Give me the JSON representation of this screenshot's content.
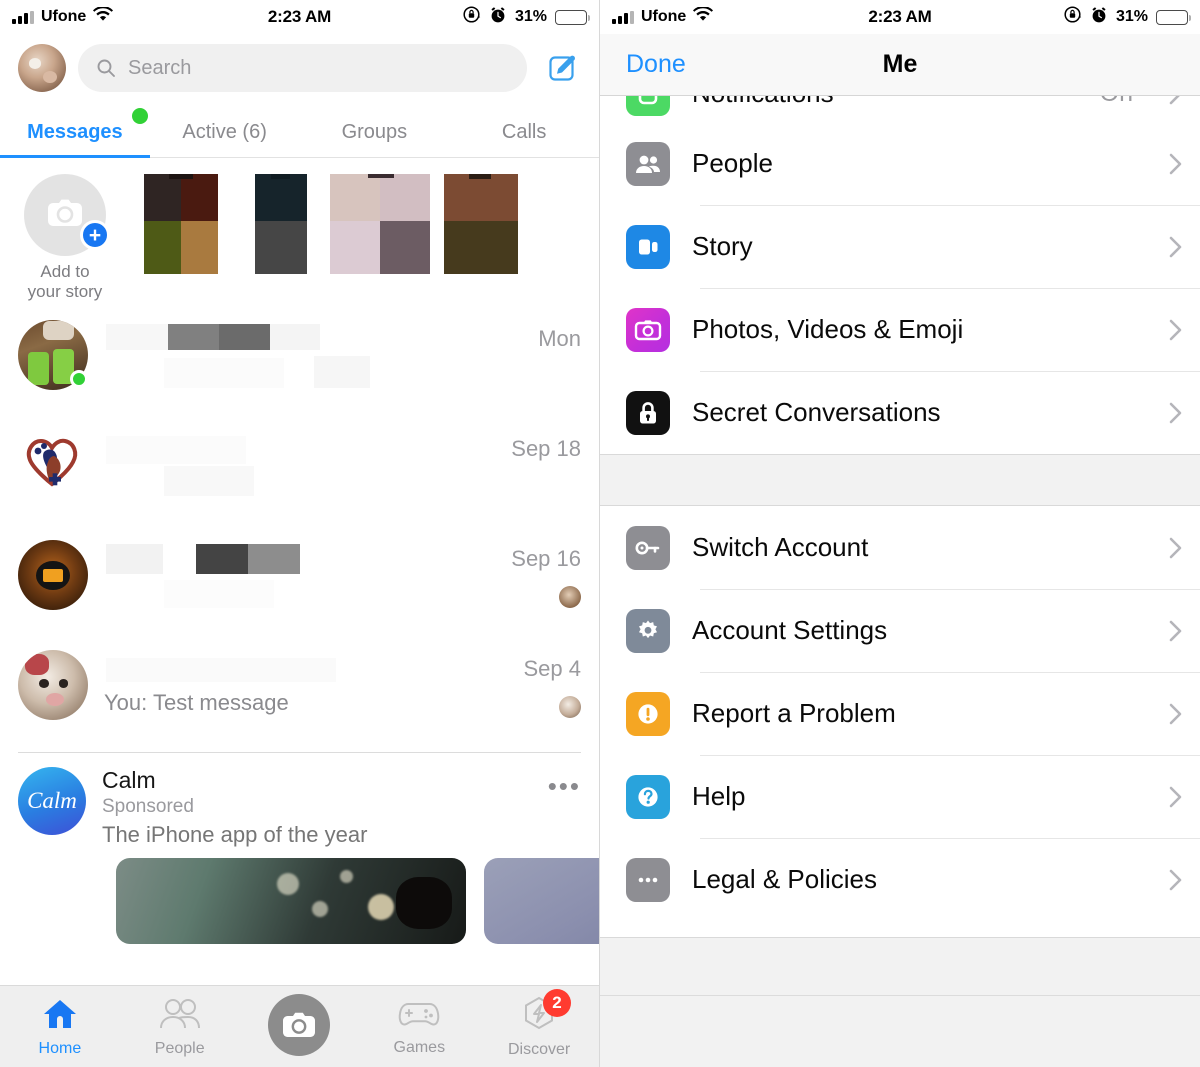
{
  "status_bar": {
    "carrier": "Ufone",
    "time": "2:23 AM",
    "battery_percent": "31%",
    "signal_icon": "cellular-signal-icon",
    "wifi_icon": "wifi-icon",
    "rotation_lock_icon": "rotation-lock-icon",
    "alarm_icon": "alarm-clock-icon",
    "battery_icon": "battery-icon"
  },
  "messenger": {
    "search": {
      "placeholder": "Search"
    },
    "profile_avatar": "user-avatar",
    "compose_icon": "compose-icon",
    "tabs": [
      {
        "label": "Messages",
        "active": true
      },
      {
        "label": "Active (6)",
        "active": false
      },
      {
        "label": "Groups",
        "active": false
      },
      {
        "label": "Calls",
        "active": false
      }
    ],
    "stories": {
      "add_label_line1": "Add to",
      "add_label_line2": "your story",
      "camera_icon": "camera-icon",
      "plus_badge": "+"
    },
    "conversations": [
      {
        "time": "Mon",
        "preview": "",
        "online": true,
        "seen": false
      },
      {
        "time": "Sep 18",
        "preview": "",
        "online": false,
        "seen": false
      },
      {
        "time": "Sep 16",
        "preview": "",
        "online": false,
        "seen": true
      },
      {
        "time": "Sep 4",
        "preview": "You: Test message",
        "online": false,
        "seen": true
      }
    ],
    "sponsored": {
      "logo_text": "Calm",
      "title": "Calm",
      "label": "Sponsored",
      "description": "The iPhone app of the year",
      "more_icon": "more-options-icon"
    },
    "tab_bar": [
      {
        "label": "Home",
        "icon": "home-icon",
        "active": true,
        "badge": ""
      },
      {
        "label": "People",
        "icon": "people-icon",
        "active": false,
        "badge": ""
      },
      {
        "label": "",
        "icon": "camera-icon",
        "active": false,
        "badge": ""
      },
      {
        "label": "Games",
        "icon": "games-controller-icon",
        "active": false,
        "badge": ""
      },
      {
        "label": "Discover",
        "icon": "discover-icon",
        "active": false,
        "badge": "2"
      }
    ]
  },
  "settings_panel": {
    "nav": {
      "done_label": "Done",
      "title": "Me"
    },
    "group1": [
      {
        "label": "Notifications",
        "value": "On",
        "icon": "notifications-icon",
        "icon_color": "#4cd964",
        "clipped": true
      },
      {
        "label": "People",
        "value": "",
        "icon": "people-icon",
        "icon_color": "#8e8e93"
      },
      {
        "label": "Story",
        "value": "",
        "icon": "story-icon",
        "icon_color": "#1e88e5"
      },
      {
        "label": "Photos, Videos & Emoji",
        "value": "",
        "icon": "camera-icon",
        "icon_color": "#cc2fd4"
      },
      {
        "label": "Secret Conversations",
        "value": "",
        "icon": "lock-icon",
        "icon_color": "#111111"
      }
    ],
    "group2": [
      {
        "label": "Switch Account",
        "value": "",
        "icon": "key-icon",
        "icon_color": "#8e8e93"
      },
      {
        "label": "Account Settings",
        "value": "",
        "icon": "gear-icon",
        "icon_color": "#7f8a99"
      },
      {
        "label": "Report a Problem",
        "value": "",
        "icon": "warning-icon",
        "icon_color": "#f5a623"
      },
      {
        "label": "Help",
        "value": "",
        "icon": "question-icon",
        "icon_color": "#29a3dc"
      },
      {
        "label": "Legal & Policies",
        "value": "",
        "icon": "ellipsis-icon",
        "icon_color": "#8e8e93"
      }
    ]
  },
  "colors": {
    "accent_blue": "#1e90ff",
    "badge_red": "#ff3b30",
    "online_green": "#31d136",
    "section_gray": "#f2f2f2"
  }
}
